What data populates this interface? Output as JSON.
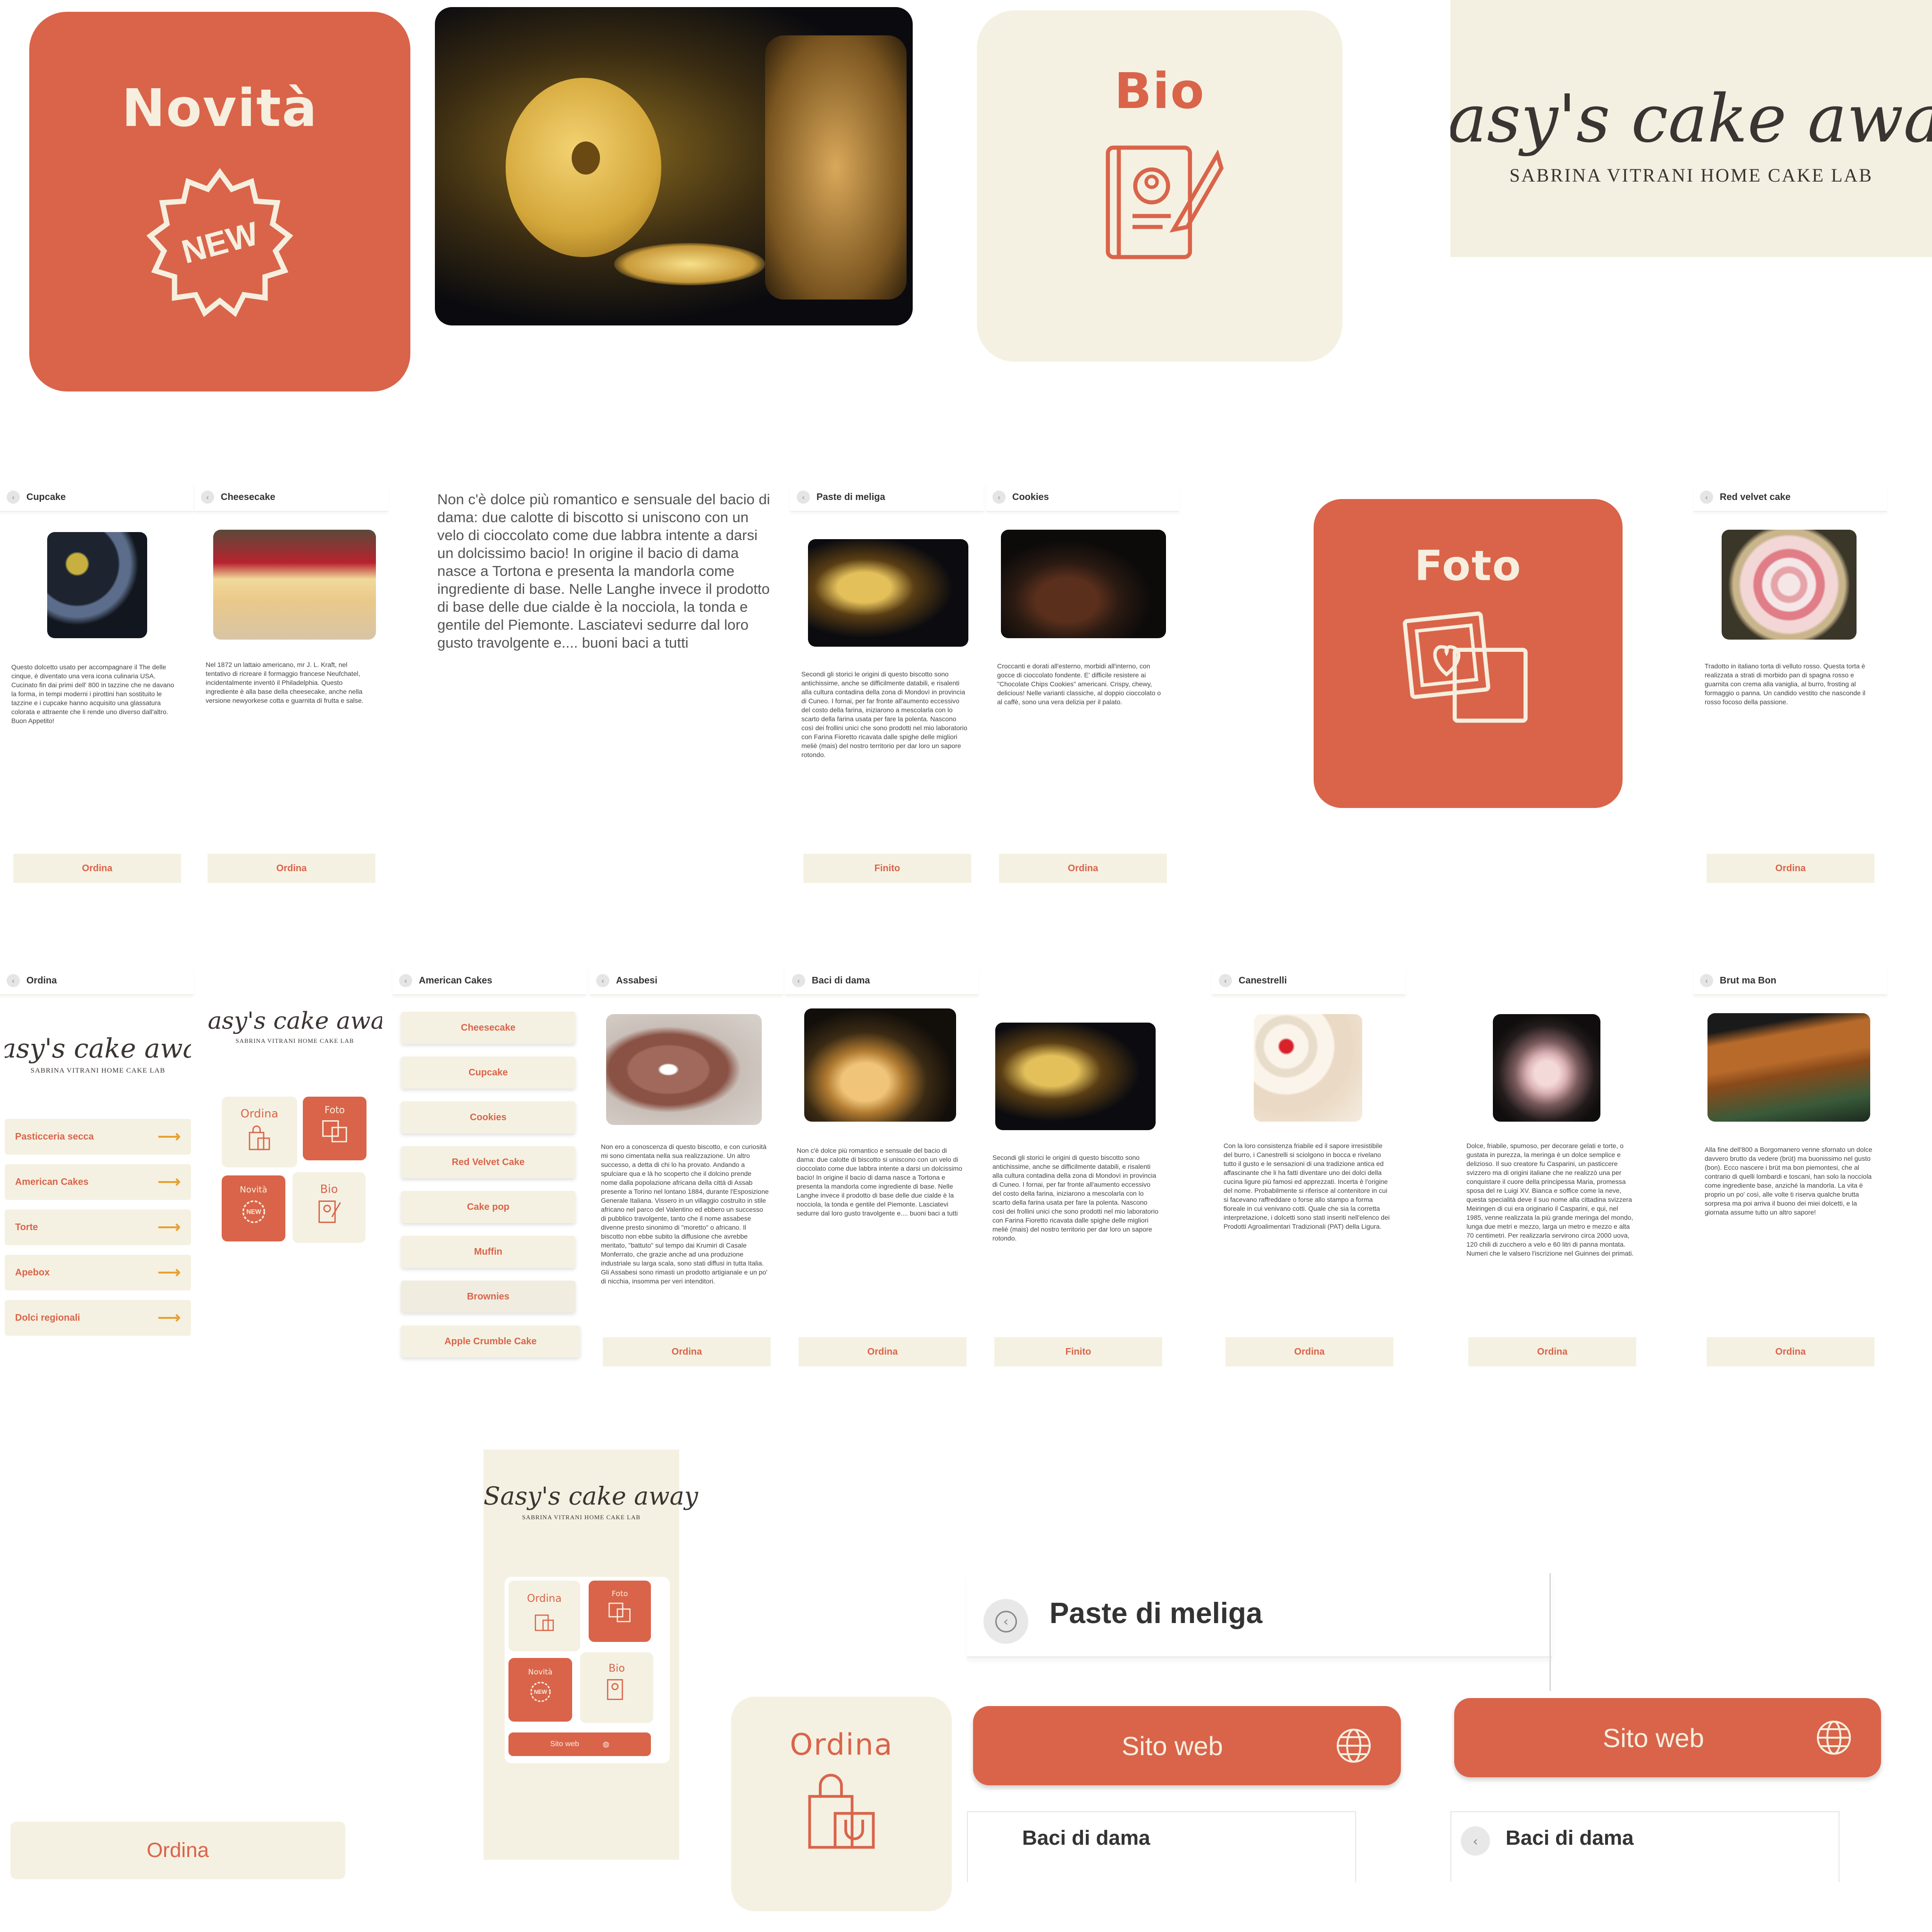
{
  "tiles": {
    "novita": "Novità",
    "new_badge": "NEW",
    "bio": "Bio",
    "foto": "Foto",
    "ordina": "Ordina"
  },
  "logo": {
    "script": "Sasy's cake away",
    "subtitle": "SABRINA VITRANI HOME CAKE LAB"
  },
  "baci_paragraph": "Non c'è dolce più romantico e sensuale del bacio di dama:  due calotte di biscotto si uniscono con un velo di cioccolato come due labbra intente a darsi un dolcissimo bacio! In origine il bacio di dama nasce a Tortona e presenta la mandorla come ingrediente di base. Nelle Langhe invece il prodotto di base delle due cialde è la nocciola, la tonda e gentile del Piemonte. Lasciatevi sedurre dal loro gusto travolgente e.... buoni baci a tutti",
  "row1_cards": [
    {
      "title": "Cupcake",
      "text": "Questo dolcetto usato per accompagnare il The delle cinque, è diventato una vera icona culinaria USA. Cucinato fin dai primi dell' 800 in tazzine che ne davano la forma, in tempi moderni i pirottini han sostituito le tazzine e i cupcake hanno acquisito una glassatura colorata e attraente che li rende uno diverso dall'altro. Buon Appetito!",
      "button": "Ordina"
    },
    {
      "title": "Cheesecake",
      "text": "Nel 1872 un lattaio americano, mr J. L. Kraft, nel tentativo di ricreare il formaggio francese Neufchatel, incidentalmente inventò il Philadelphia. Questo ingrediente è alla base della cheesecake, anche nella versione newyorkese cotta e guarnita di frutta e salse.",
      "button": "Ordina"
    },
    {
      "title": "Paste di meliga",
      "text": "Secondi gli storici le origini di questo biscotto sono antichissime, anche se difficilmente databili, e risalenti alla cultura contadina della zona di Mondovì in provincia di Cuneo. I fornai, per far fronte all'aumento eccessivo del costo della farina, iniziarono a mescolarla con lo scarto della farina usata per fare la polenta. Nascono così dei frollini unici che sono prodotti nel mio laboratorio con Farina Fioretto ricavata dalle spighe delle migliori meliè (mais) del nostro territorio per dar loro un sapore rotondo.",
      "button": "Finito"
    },
    {
      "title": "Cookies",
      "text": "Croccanti e dorati all'esterno, morbidi all'interno, con gocce di cioccolato fondente. E' difficile resistere ai \"Chocolate Chips Cookies\" americani. Crispy, chewy, delicious! Nelle varianti classiche, al doppio cioccolato o al caffè, sono una vera delizia per il palato.",
      "button": "Ordina"
    },
    {
      "title": "Red velvet cake",
      "text": "Tradotto in italiano torta di velluto rosso. Questa torta è realizzata a strati di morbido pan di spagna rosso e guarnita con crema alla vaniglia, al burro, frosting al formaggio o panna.  Un candido vestito che nasconde il rosso focoso della passione.",
      "button": "Ordina"
    }
  ],
  "ordina_screen": {
    "title": "Ordina",
    "items": [
      "Pasticceria secca",
      "American Cakes",
      "Torte",
      "Apebox",
      "Dolci regionali"
    ]
  },
  "home_grid": {
    "ordina": "Ordina",
    "foto": "Foto",
    "novita": "Novità",
    "bio": "Bio",
    "sito": "Sito web"
  },
  "american_cakes": {
    "title": "American Cakes",
    "items": [
      "Cheesecake",
      "Cupcake",
      "Cookies",
      "Red Velvet Cake",
      "Cake pop",
      "Muffin",
      "Brownies",
      "Apple Crumble Cake"
    ]
  },
  "row2_cards": [
    {
      "title": "Assabesi",
      "text": "Non ero a conoscenza di questo biscotto, e con curiosità mi sono cimentata nella sua realizzazione. Un altro successo, a detta di chi lo ha provato. Andando a spulciare qua e là ho scoperto che il dolcino prende nome dalla popolazione africana della città di Assab presente a Torino nel lontano 1884, durante l'Esposizione Generale Italiana. Vissero in un villaggio costruito in stile africano nel parco del Valentino ed ebbero un successo di pubblico travolgente, tanto che il nome assabese divenne presto sinonimo di \"moretto\" o africano. Il biscotto non ebbe subito la diffusione che avrebbe meritato, \"battuto\" sul tempo dai Krumiri di Casale Monferrato, che grazie anche ad una produzione industriale su larga scala, sono stati diffusi in tutta Italia. Gli Assabesi sono rimasti un prodotto artigianale e un po' di nicchia, insomma per veri intenditori.",
      "button": "Ordina"
    },
    {
      "title": "Baci di dama",
      "text": "Non c'è dolce più romantico e sensuale del bacio di dama:  due calotte di biscotto si uniscono con un velo di cioccolato come due labbra intente a darsi un dolcissimo bacio! In origine il bacio di dama nasce a Tortona e presenta la mandorla come ingrediente di base. Nelle Langhe invece il prodotto di base delle due cialde è la nocciola, la tonda e gentile del Piemonte. Lasciatevi sedurre dal loro gusto travolgente e.... buoni baci a tutti",
      "button": "Ordina"
    },
    {
      "title": "",
      "text": "Secondi gli storici le origini di questo biscotto sono antichissime, anche se difficilmente databili, e risalenti alla cultura contadina della zona di Mondovì in provincia di Cuneo. I fornai, per far fronte all'aumento eccessivo del costo della farina, iniziarono a mescolarla con lo scarto della farina usata per fare la polenta. Nascono così dei frollini unici che sono prodotti nel mio laboratorio con Farina Fioretto ricavata dalle spighe delle migliori meliè (mais) del nostro territorio per dar loro un sapore rotondo.",
      "button": "Finito"
    },
    {
      "title": "Canestrelli",
      "text": "Con la loro consistenza friabile ed il sapore irresistibile del burro, i Canestrelli si sciolgono in bocca e rivelano tutto il gusto e le sensazioni di una tradizione antica ed affascinante che li ha fatti diventare uno dei dolci della cucina ligure più famosi ed apprezzati. Incerta è l'origine del nome. Probabilmente si riferisce al contenitore in cui si facevano raffreddare o forse allo stampo a forma floreale in cui venivano cotti. Quale che sia la corretta interpretazione, i dolcetti sono stati inseriti nell'elenco dei Prodotti Agroalimentari Tradizionali (PAT) della Ligura.",
      "button": "Ordina"
    },
    {
      "title": "",
      "text": "Dolce, friabile, spumoso, per decorare gelati e torte, o gustata in purezza, la meringa è un dolce semplice e delizioso. Il suo creatore fu Casparini, un pasticcere svizzero ma di origini italiane che ne realizzò una per conquistare il cuore della principessa Maria, promessa sposa del re Luigi XV. Bianca e soffice come la neve, questa specialità deve il suo nome alla cittadina svizzera Meiringen di cui era originario il Casparini, e qui, nel 1985, venne realizzata la più grande meringa del mondo, lunga due metri e mezzo, larga un metro e mezzo e alta 70 centimetri. Per realizzarla servirono circa 2000 uova, 120 chili di zucchero a velo e 60 litri di panna montata. Numeri che le valsero l'iscrizione nel Guinnes dei primati.",
      "button": "Ordina"
    },
    {
      "title": "Brut ma Bon",
      "text": "Alla fine dell'800 a Borgomanero venne sfornato un dolce davvero brutto da vedere (brüt) ma buonissimo nel gusto (bon). Ecco nascere i brüt ma bon piemontesi, che al contrario di quelli lombardi e toscani, han solo la nocciola come ingrediente base, anziché la mandorla. La vita è proprio un po' così, alle volte ti riserva qualche brutta sorpresa ma poi arriva il buono dei miei dolcetti, e la giornata assume tutto un altro sapore!",
      "button": "Ordina"
    }
  ],
  "bottom": {
    "ordina_button": "Ordina",
    "phone_grid": {
      "ordina": "Ordina",
      "foto": "Foto",
      "novita": "Novità",
      "bio": "Bio",
      "sito": "Sito web"
    },
    "header_title": "Paste di meliga",
    "sito_web": "Sito web",
    "baci_header": "Baci di dama"
  },
  "colors": {
    "accent": "#d9644a",
    "cream": "#f5f1e2",
    "arrow": "#e8a030"
  },
  "icons": [
    "new-badge-icon",
    "bio-book-icon",
    "photo-heart-icon",
    "shopping-bags-icon",
    "globe-icon",
    "back-arrow-icon",
    "right-arrow-icon"
  ]
}
